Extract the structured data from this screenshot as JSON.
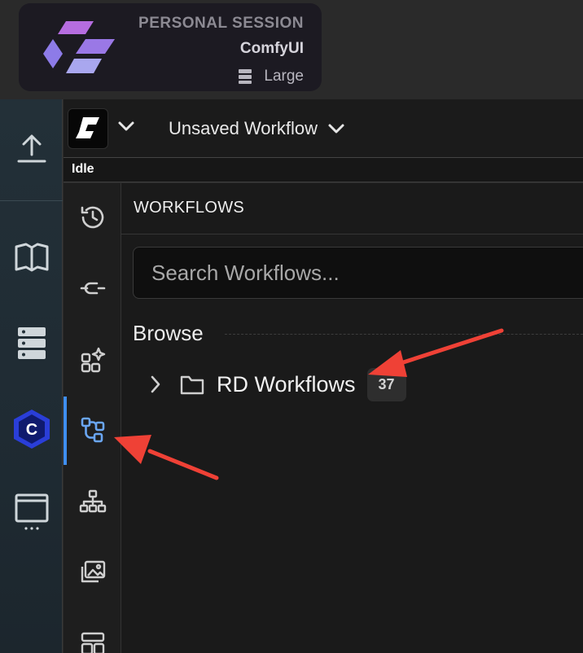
{
  "session": {
    "kicker": "PERSONAL SESSION",
    "name": "ComfyUI",
    "size": "Large"
  },
  "header": {
    "workflow_title": "Unsaved Workflow",
    "status": "Idle"
  },
  "outer_rail": {
    "icons": [
      "upload-icon",
      "book-icon",
      "server-stack-icon",
      "comfy-hex-logo-icon",
      "monitor-icon"
    ]
  },
  "inner_rail": {
    "icons": [
      "history-icon",
      "node-library-icon",
      "model-library-icon",
      "workflows-icon",
      "node-map-icon",
      "images-icon",
      "templates-icon"
    ],
    "active": "workflows-icon"
  },
  "panel": {
    "title": "WORKFLOWS",
    "search_placeholder": "Search Workflows...",
    "browse_heading": "Browse",
    "tree": [
      {
        "label": "RD Workflows",
        "count": "37",
        "expanded": false
      }
    ]
  },
  "colors": {
    "accent": "#3f8ef0",
    "annotation_arrow": "#ef4136"
  }
}
